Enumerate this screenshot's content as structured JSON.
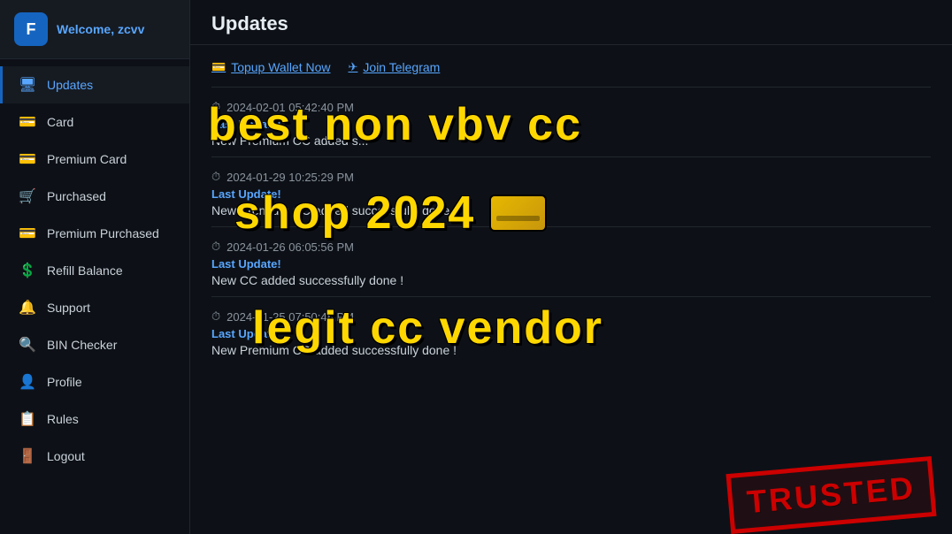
{
  "header": {
    "welcome_text": "Welcome, ",
    "username": "zcvv",
    "logo_letter": "F"
  },
  "sidebar": {
    "items": [
      {
        "id": "updates",
        "label": "Updates",
        "icon": "🖥",
        "active": true
      },
      {
        "id": "card",
        "label": "Card",
        "icon": "💳",
        "active": false
      },
      {
        "id": "premium-card",
        "label": "Premium Card",
        "icon": "💳",
        "active": false
      },
      {
        "id": "purchased",
        "label": "Purchased",
        "icon": "🛒",
        "active": false
      },
      {
        "id": "premium-purchased",
        "label": "Premium Purchased",
        "icon": "💳",
        "active": false
      },
      {
        "id": "refill-balance",
        "label": "Refill Balance",
        "icon": "💲",
        "active": false
      },
      {
        "id": "support",
        "label": "Support",
        "icon": "🔔",
        "active": false
      },
      {
        "id": "bin-checker",
        "label": "BIN Checker",
        "icon": "🔍",
        "active": false
      },
      {
        "id": "profile",
        "label": "Profile",
        "icon": "👤",
        "active": false
      },
      {
        "id": "rules",
        "label": "Rules",
        "icon": "📋",
        "active": false
      },
      {
        "id": "logout",
        "label": "Logout",
        "icon": "🚪",
        "active": false
      }
    ]
  },
  "main": {
    "title": "Updates",
    "links": [
      {
        "id": "topup",
        "label": "Topup Wallet Now",
        "icon": "topup"
      },
      {
        "id": "telegram",
        "label": "Join Telegram",
        "icon": "telegram"
      }
    ],
    "updates": [
      {
        "timestamp": "2024-02-01 05:42:40 PM",
        "label": "Last Update!",
        "message": "New Premium CC added s..."
      },
      {
        "timestamp": "2024-01-29 10:25:29 PM",
        "label": "Last Update!",
        "message": "New Premium CC added successfully done !"
      },
      {
        "timestamp": "2024-01-26 06:05:56 PM",
        "label": "Last Update!",
        "message": "New CC added successfully done !"
      },
      {
        "timestamp": "2024-01-25 07:50:48 PM",
        "label": "Last Update",
        "message": "New Premium CC added successfully done !"
      }
    ]
  },
  "overlay": {
    "line1": "best non vbv cc",
    "line2": "shop 2024",
    "line3": "legit cc vendor",
    "stamp": "TRUSTED"
  }
}
